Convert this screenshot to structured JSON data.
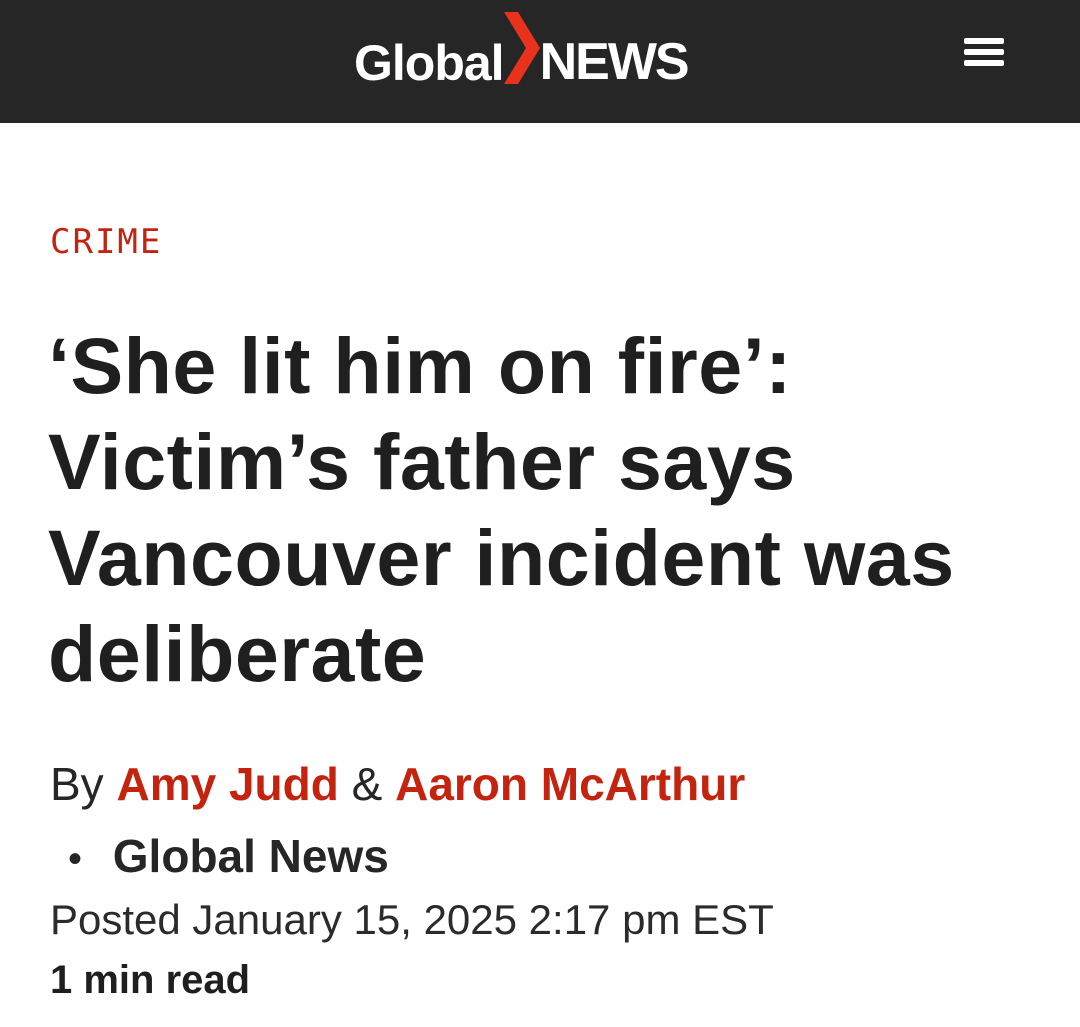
{
  "header": {
    "logo": {
      "word1": "Global",
      "word2": "NEWS",
      "accent_color": "#e8321b"
    },
    "menu_icon": "hamburger-menu-icon",
    "background_color": "#262626"
  },
  "article": {
    "category": "CRIME",
    "category_color": "#c4240f",
    "headline": "‘She lit him on fire’: Victim’s father says Vancouver incident was deliberate",
    "byline": {
      "prefix": "By",
      "authors": [
        "Amy Judd",
        "Aaron McArthur"
      ],
      "separator": "&",
      "bullet": "•",
      "outlet": "Global News"
    },
    "posted": "Posted January 15, 2025 2:17 pm EST",
    "read_time": "1 min read"
  }
}
